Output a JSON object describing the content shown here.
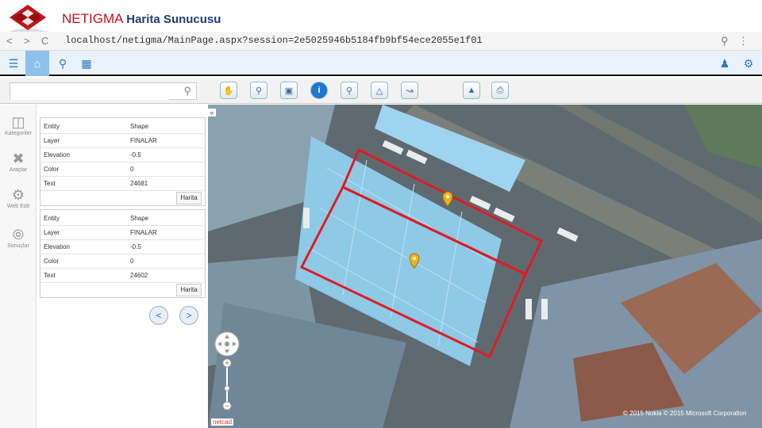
{
  "header": {
    "title": "NETIGMA",
    "subtitle": "Harita Sunucusu"
  },
  "browser": {
    "url": "localhost/netigma/MainPage.aspx?session=2e5025946b5184fb9bf54ece2055e1f01",
    "back": "<",
    "forward": ">",
    "reload": "C"
  },
  "search": {
    "placeholder": ""
  },
  "left_nav": [
    {
      "label": "Kategoriler",
      "icon": "folder-icon"
    },
    {
      "label": "Araçlar",
      "icon": "tools-icon"
    },
    {
      "label": "Web Edit",
      "icon": "gear-icon"
    },
    {
      "label": "Sonuçlar",
      "icon": "compass-icon"
    }
  ],
  "results": [
    {
      "rows": [
        {
          "key": "Entity",
          "value": "Shape"
        },
        {
          "key": "Layer",
          "value": "FINALAR"
        },
        {
          "key": "Elevation",
          "value": "-0.5"
        },
        {
          "key": "Color",
          "value": "0"
        },
        {
          "key": "Text",
          "value": "24681"
        }
      ],
      "button": "Harita"
    },
    {
      "rows": [
        {
          "key": "Entity",
          "value": "Shape"
        },
        {
          "key": "Layer",
          "value": "FINALAR"
        },
        {
          "key": "Elevation",
          "value": "-0.5"
        },
        {
          "key": "Color",
          "value": "0"
        },
        {
          "key": "Text",
          "value": "24602"
        }
      ],
      "button": "Harita"
    }
  ],
  "pager": {
    "prev": "<",
    "next": ">"
  },
  "map": {
    "credit": "© 2015 Nokia © 2015 Microsoft Corporation",
    "brand": "netcad",
    "collapse": "«"
  },
  "colors": {
    "accent": "#2b78c2",
    "title_red": "#c0141b",
    "selection": "#e01b24"
  }
}
